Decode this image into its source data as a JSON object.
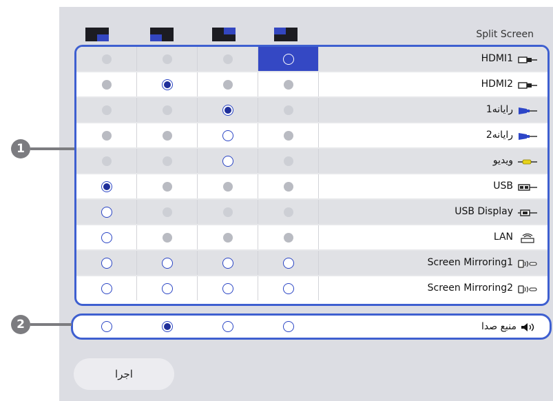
{
  "title": "Split Screen",
  "layout_icons": [
    "layout-bottom-right-icon",
    "layout-bottom-left-icon",
    "layout-top-right-icon",
    "layout-top-left-icon"
  ],
  "sources": [
    {
      "label": "HDMI1",
      "icon": "hdmi-icon",
      "states": [
        "dot",
        "dot",
        "dot",
        "empty"
      ],
      "highlight_col": 3
    },
    {
      "label": "HDMI2",
      "icon": "hdmi-icon",
      "states": [
        "dot",
        "sel",
        "dot",
        "dot"
      ]
    },
    {
      "label": "رایانه1",
      "icon": "vga-icon",
      "states": [
        "dot",
        "dot",
        "sel",
        "dot"
      ]
    },
    {
      "label": "رایانه2",
      "icon": "vga-icon",
      "states": [
        "dot",
        "dot",
        "empty",
        "dot"
      ]
    },
    {
      "label": "ویدیو",
      "icon": "rca-video-icon",
      "states": [
        "dot",
        "dot",
        "empty",
        "dot"
      ]
    },
    {
      "label": "USB",
      "icon": "usb-icon",
      "states": [
        "sel",
        "dot",
        "dot",
        "dot"
      ]
    },
    {
      "label": "USB Display",
      "icon": "usb-display-icon",
      "states": [
        "empty",
        "dot",
        "dot",
        "dot"
      ]
    },
    {
      "label": "LAN",
      "icon": "lan-icon",
      "states": [
        "empty",
        "dot",
        "dot",
        "dot"
      ]
    },
    {
      "label": "Screen Mirroring1",
      "icon": "screen-mirroring-icon",
      "states": [
        "empty",
        "empty",
        "empty",
        "empty"
      ]
    },
    {
      "label": "Screen Mirroring2",
      "icon": "screen-mirroring-icon",
      "states": [
        "empty",
        "empty",
        "empty",
        "empty"
      ]
    }
  ],
  "audio": {
    "label": "منبع صدا",
    "icon": "speaker-icon",
    "states": [
      "empty",
      "sel",
      "empty",
      "empty"
    ]
  },
  "callouts": [
    "1",
    "2"
  ],
  "apply_label": "اجرا",
  "colors": {
    "accent": "#3e5fd0",
    "highlight": "#3448c4",
    "selected_dot": "#1f2f9a",
    "panel": "#dcdde3"
  }
}
